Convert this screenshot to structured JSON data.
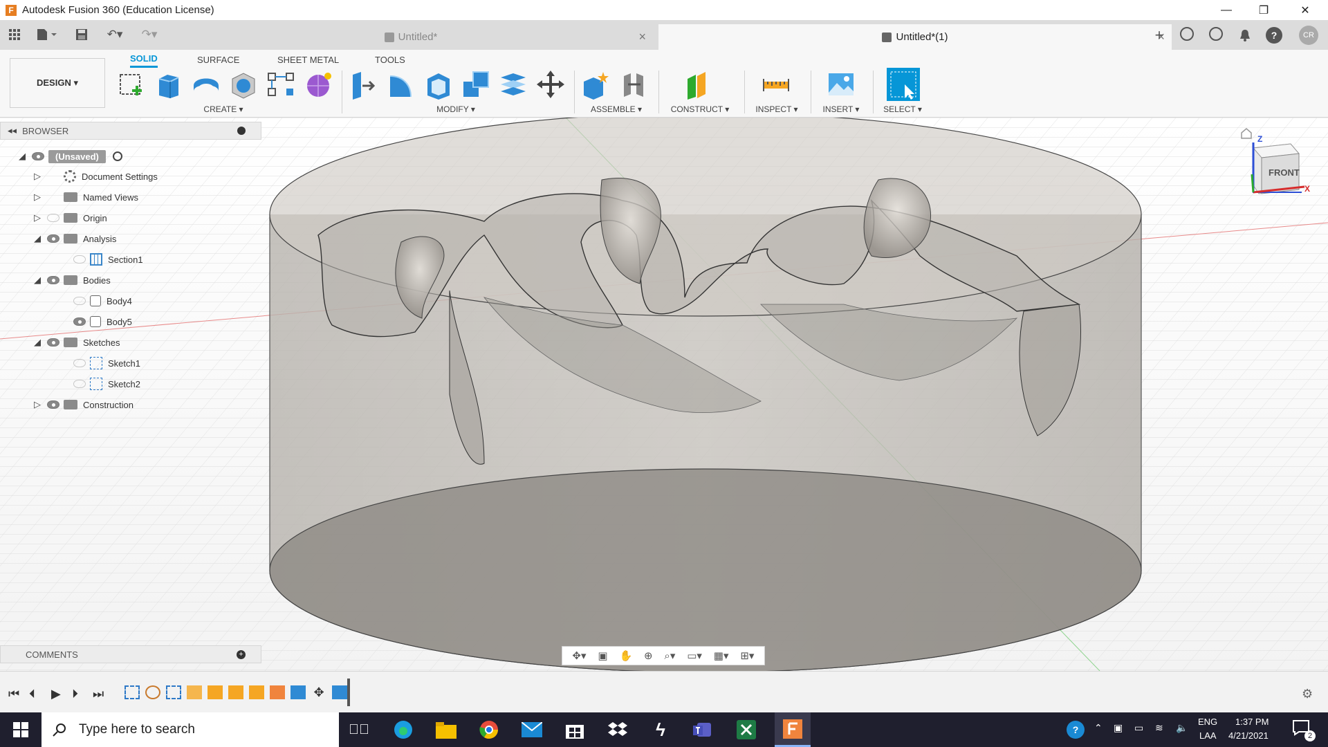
{
  "window": {
    "title": "Autodesk Fusion 360 (Education License)",
    "minimize": "—",
    "restore": "❐",
    "close": "✕"
  },
  "tabs": [
    {
      "label": "Untitled*",
      "close": "×"
    },
    {
      "label": "Untitled*(1)",
      "close": "×"
    }
  ],
  "user_initials": "CR",
  "ribbon": {
    "workspace": "DESIGN ▾",
    "mode_tabs": [
      "SOLID",
      "SURFACE",
      "SHEET METAL",
      "TOOLS"
    ],
    "groups": [
      "CREATE ▾",
      "MODIFY ▾",
      "ASSEMBLE ▾",
      "CONSTRUCT ▾",
      "INSPECT ▾",
      "INSERT ▾",
      "SELECT ▾"
    ]
  },
  "browser": {
    "title": "BROWSER",
    "root": "(Unsaved)",
    "items": [
      {
        "label": "Document Settings",
        "type": "settings"
      },
      {
        "label": "Named Views",
        "type": "folder"
      },
      {
        "label": "Origin",
        "type": "folder"
      },
      {
        "label": "Analysis",
        "type": "folder"
      },
      {
        "label": "Section1",
        "type": "section"
      },
      {
        "label": "Bodies",
        "type": "folder"
      },
      {
        "label": "Body4",
        "type": "body"
      },
      {
        "label": "Body5",
        "type": "body"
      },
      {
        "label": "Sketches",
        "type": "folder"
      },
      {
        "label": "Sketch1",
        "type": "sketch"
      },
      {
        "label": "Sketch2",
        "type": "sketch"
      },
      {
        "label": "Construction",
        "type": "folder"
      }
    ]
  },
  "comments": {
    "title": "COMMENTS"
  },
  "viewcube": {
    "face": "FRONT",
    "z": "Z",
    "x": "X"
  },
  "taskbar": {
    "search_placeholder": "Type here to search",
    "lang": "ENG",
    "region": "LAA",
    "time": "1:37 PM",
    "date": "4/21/2021",
    "notifications": "2"
  },
  "colors": {
    "accent": "#0696d7",
    "taskbar": "#1f1f2e"
  }
}
